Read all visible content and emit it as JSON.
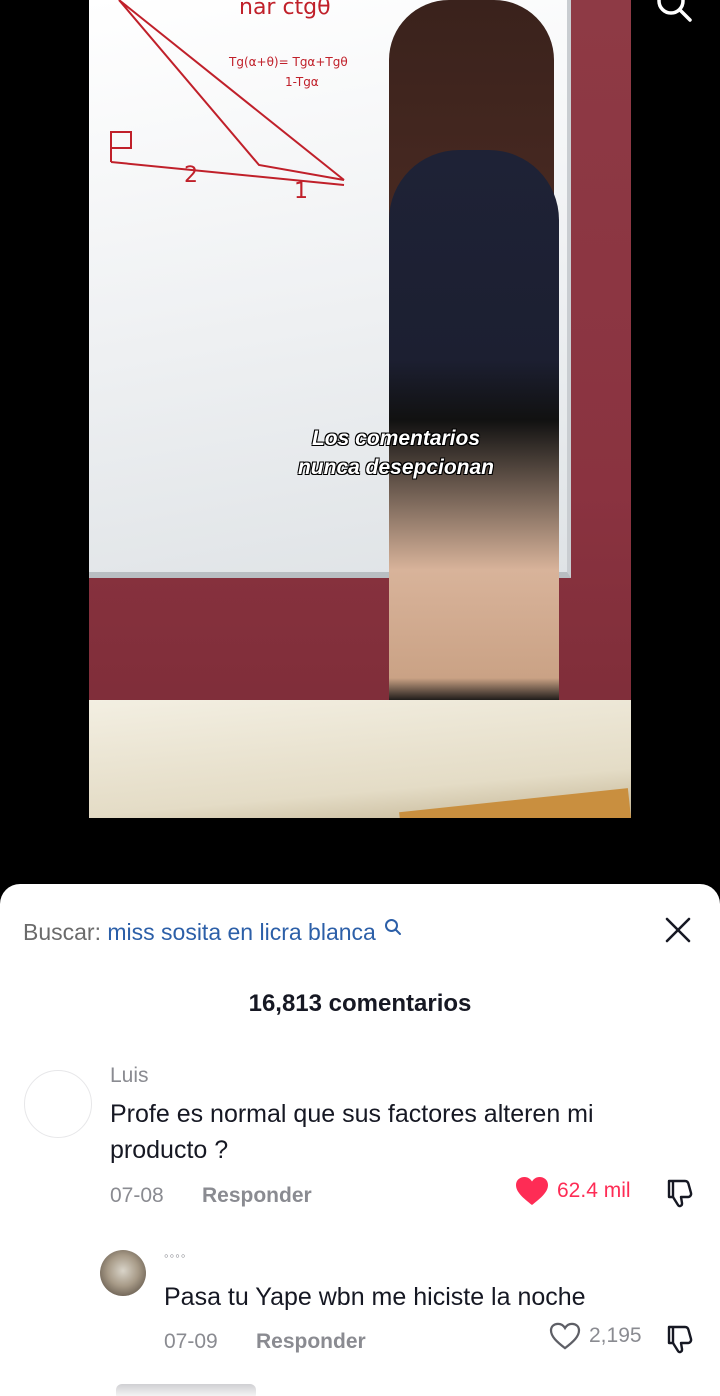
{
  "video": {
    "caption_line1": "Los comentarios",
    "caption_line2": "nunca desepcionan"
  },
  "top_bar": {
    "search_icon": "search-icon"
  },
  "comments_sheet": {
    "search_prefix": "Buscar:",
    "search_query": "miss sosita en licra blanca",
    "search_icon": "search-icon",
    "close_icon": "close-icon",
    "comment_count_label": "16,813 comentarios",
    "comments": [
      {
        "username": "Luis",
        "text": "Profe es normal que sus factores alteren mi producto ?",
        "date": "07-08",
        "reply_label": "Responder",
        "likes": "62.4 mil",
        "liked": true,
        "like_color": "#fe2c55"
      },
      {
        "username": "◦◦◦◦",
        "text": "Pasa tu Yape wbn me hiciste la noche",
        "date": "07-09",
        "reply_label": "Responder",
        "likes": "2,195",
        "liked": false
      }
    ]
  }
}
